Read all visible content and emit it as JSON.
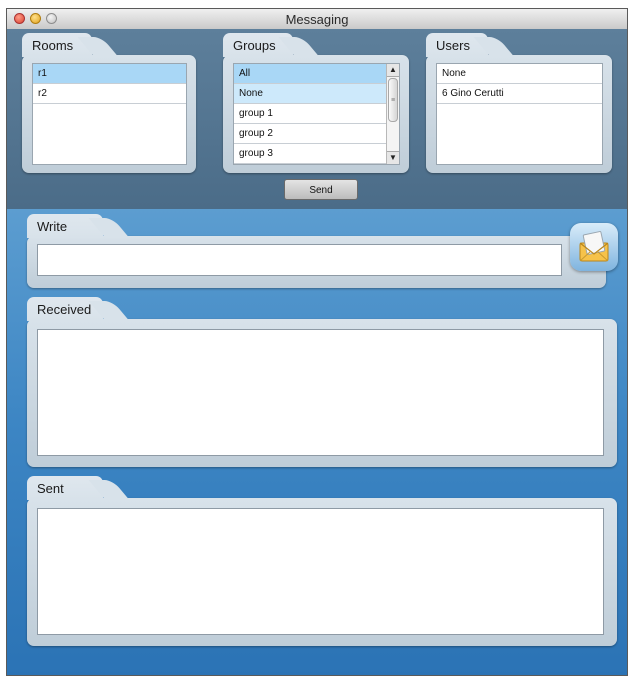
{
  "window": {
    "title": "Messaging"
  },
  "rooms": {
    "label": "Rooms",
    "items": [
      "r1",
      "r2"
    ]
  },
  "groups": {
    "label": "Groups",
    "items": [
      "All",
      "None",
      "group 1",
      "group 2",
      "group 3"
    ]
  },
  "users": {
    "label": "Users",
    "items": [
      "None",
      "6 Gino Cerutti"
    ]
  },
  "actions": {
    "send_label": "Send"
  },
  "write": {
    "label": "Write",
    "value": ""
  },
  "received": {
    "label": "Received",
    "value": ""
  },
  "sent": {
    "label": "Sent",
    "value": ""
  },
  "icons": {
    "mail": "envelope-icon"
  },
  "colors": {
    "selection": "#a9d7f6",
    "background_top": "#4a6f8f",
    "background_bottom": "#2b73b5"
  }
}
